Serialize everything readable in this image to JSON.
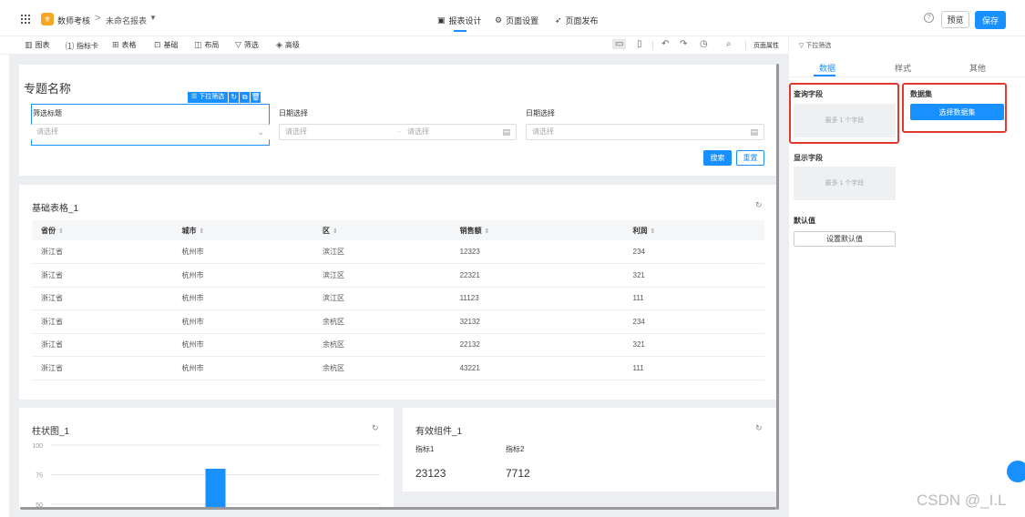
{
  "header": {
    "app_logo": "⚜",
    "app_name": "数师考核",
    "breadcrumb_sep": ">",
    "report_name": "未命名报表",
    "tabs": [
      {
        "label": "报表设计",
        "icon": "report-icon"
      },
      {
        "label": "页面设置",
        "icon": "settings-icon"
      },
      {
        "label": "页面发布",
        "icon": "publish-icon"
      }
    ],
    "preview_label": "预览",
    "save_label": "保存"
  },
  "toolbar": {
    "items": [
      {
        "label": "图表",
        "icon": "bar-chart-icon"
      },
      {
        "label": "指标卡",
        "icon": "metric-card-icon"
      },
      {
        "label": "表格",
        "icon": "table-icon"
      },
      {
        "label": "基础",
        "icon": "basic-icon"
      },
      {
        "label": "布局",
        "icon": "layout-icon"
      },
      {
        "label": "筛选",
        "icon": "filter-icon"
      },
      {
        "label": "高级",
        "icon": "advanced-icon"
      }
    ],
    "page_props_label": "页面属性"
  },
  "filter_card": {
    "title": "专题名称",
    "tag_label": "下拉筛选",
    "filters": [
      {
        "label": "筛选标题",
        "placeholder": "请选择"
      },
      {
        "label": "日期选择",
        "placeholder_start": "请选择",
        "placeholder_end": "请选择",
        "separator": "-"
      },
      {
        "label": "日期选择",
        "placeholder": "请选择"
      }
    ],
    "search_label": "搜索",
    "reset_label": "重置"
  },
  "table_card": {
    "title": "基础表格_1",
    "columns": [
      "省份",
      "城市",
      "区",
      "销售额",
      "利润"
    ],
    "rows": [
      [
        "浙江省",
        "杭州市",
        "滨江区",
        "12323",
        "234"
      ],
      [
        "浙江省",
        "杭州市",
        "滨江区",
        "22321",
        "321"
      ],
      [
        "浙江省",
        "杭州市",
        "滨江区",
        "11123",
        "111"
      ],
      [
        "浙江省",
        "杭州市",
        "余杭区",
        "32132",
        "234"
      ],
      [
        "浙江省",
        "杭州市",
        "余杭区",
        "22132",
        "321"
      ],
      [
        "浙江省",
        "杭州市",
        "余杭区",
        "43221",
        "111"
      ]
    ]
  },
  "bar_card": {
    "title": "柱状图_1"
  },
  "chart_data": {
    "type": "bar",
    "title": "柱状图_1",
    "xlabel": "",
    "ylabel": "",
    "yticks": [
      "100",
      "75",
      "50"
    ],
    "ylim": [
      50,
      100
    ],
    "categories": [
      ""
    ],
    "values": [
      80
    ],
    "grid": true,
    "color": "#1890ff"
  },
  "metric_card": {
    "title": "有效组件_1",
    "metrics": [
      {
        "label": "指标1",
        "value": "23123"
      },
      {
        "label": "指标2",
        "value": "7712"
      }
    ]
  },
  "right_panel": {
    "header": "下拉筛选",
    "tabs": [
      "数据",
      "样式",
      "其他"
    ],
    "query_field_label": "查询字段",
    "query_field_hint": "最多 1 个字段",
    "dataset_label": "数据集",
    "dataset_button": "选择数据集",
    "display_field_label": "显示字段",
    "display_field_hint": "最多 1 个字段",
    "default_label": "默认值",
    "default_button": "设置默认值"
  },
  "watermark": "CSDN @_I.L",
  "colors": {
    "accent": "#1890ff",
    "highlight": "#e03a2f",
    "canvas_bg": "#eceef1"
  }
}
